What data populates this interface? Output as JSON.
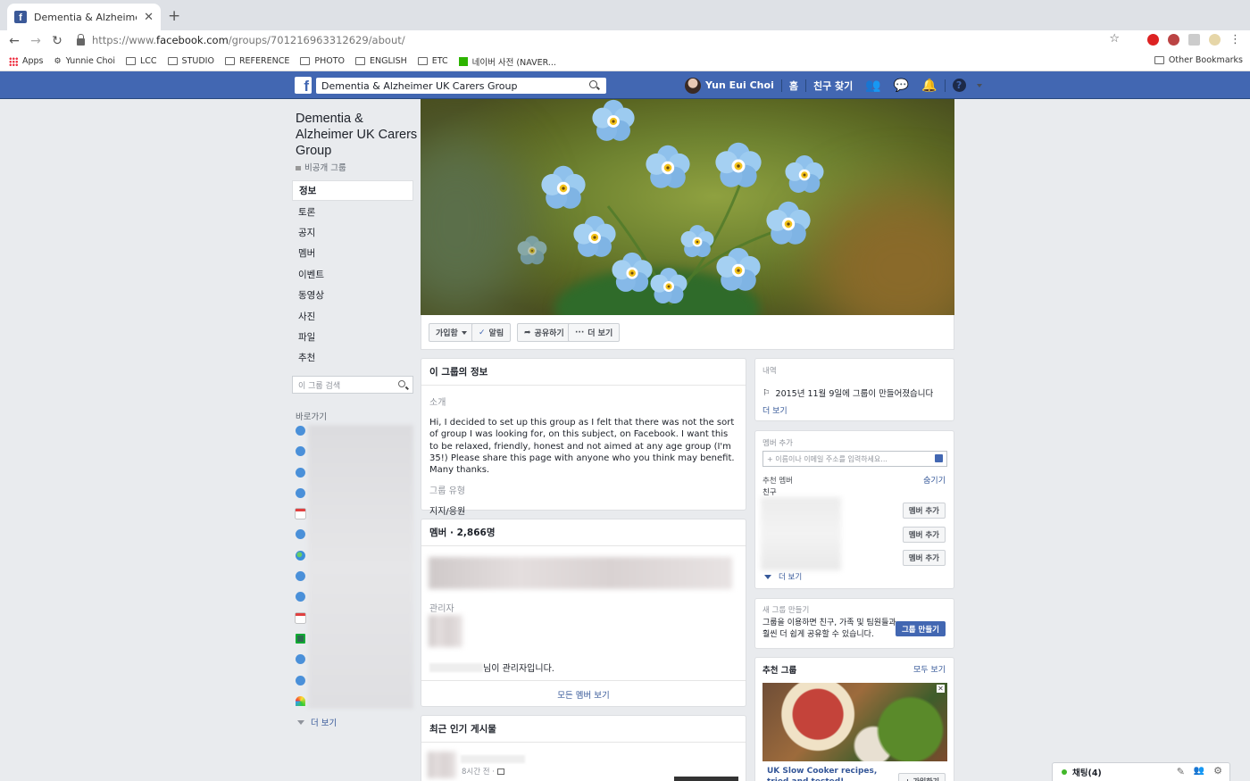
{
  "browser": {
    "tab_title": "Dementia & Alzheimer UK Care",
    "url_prefix": "https://www.",
    "url_domain": "facebook.com",
    "url_path": "/groups/701216963312629/about/",
    "bookmarks": [
      "Apps",
      "Yunnie Choi",
      "LCC",
      "STUDIO",
      "REFERENCE",
      "PHOTO",
      "ENGLISH",
      "ETC",
      "네이버 사전 (NAVER..."
    ],
    "other_bookmarks": "Other Bookmarks"
  },
  "fb": {
    "search_value": "Dementia & Alzheimer UK Carers Group",
    "user_name": "Yun Eui Choi",
    "home": "홈",
    "find_friends": "친구 찾기"
  },
  "group": {
    "name": "Dementia & Alzheimer UK Carers Group",
    "privacy": "비공개 그룹",
    "nav": [
      "정보",
      "토론",
      "공지",
      "멤버",
      "이벤트",
      "동영상",
      "사진",
      "파일",
      "추천"
    ],
    "search_placeholder": "이 그룹 검색",
    "shortcuts_title": "바로가기",
    "more": "더 보기"
  },
  "cover_actions": {
    "joined": "가입함",
    "notify": "알림",
    "share": "공유하기",
    "more": "더 보기"
  },
  "about": {
    "title": "이 그룹의 정보",
    "intro_label": "소개",
    "description": "Hi, I decided to set up this group as I felt that there was not the sort of group I was looking for, on this subject, on Facebook. I want this to be relaxed, friendly, honest and not aimed at any age group (I'm 35!) Please share this page with anyone who you think may benefit. Many thanks.",
    "type_label": "그룹 유형",
    "type_value": "지지/응원"
  },
  "members": {
    "title": "멤버 · 2,866명",
    "admin_label": "관리자",
    "admin_suffix": "님이 관리자입니다.",
    "see_all": "모든 멤버 보기"
  },
  "popular": {
    "title": "최근 인기 게시물",
    "time": "8시간 전 ·"
  },
  "history": {
    "label": "내역",
    "created": "2015년 11월 9일에 그룹이 만들어졌습니다",
    "more": "더 보기"
  },
  "add_member": {
    "label": "멤버 추가",
    "placeholder": "+ 이름이나 이메일 주소를 입력하세요...",
    "suggested": "추천 멤버",
    "hide": "숨기기",
    "friends": "친구",
    "add_btn": "멤버 추가",
    "more": "더 보기"
  },
  "create_group": {
    "label": "새 그룹 만들기",
    "text": "그룹을 이용하면 친구, 가족 및 팀원들과 훨씬 더 쉽게 공유할 수 있습니다.",
    "button": "그룹 만들기"
  },
  "suggested_groups": {
    "title": "추천 그룹",
    "see_all": "모두 보기",
    "item_name": "UK Slow Cooker recipes, tried and tested!",
    "join": "+ 가입하기"
  },
  "chat": {
    "label": "채팅(4)"
  },
  "colors": {
    "fb_blue": "#4267b2",
    "link": "#365899",
    "create_btn": "#4267b2"
  }
}
